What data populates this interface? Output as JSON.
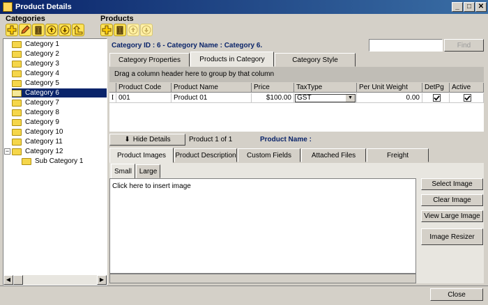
{
  "window": {
    "title": "Product Details",
    "min": "_",
    "max": "□",
    "close": "✕"
  },
  "headers": {
    "categories": "Categories",
    "products": "Products"
  },
  "toolbar_icons": {
    "categories": [
      "add-icon",
      "edit-icon",
      "delete-icon",
      "move-up-icon",
      "move-down-icon",
      "move-level-icon"
    ],
    "products": [
      "add-icon",
      "delete-icon",
      "move-up-icon",
      "move-down-icon"
    ]
  },
  "tree": {
    "items": [
      {
        "label": "Category 1"
      },
      {
        "label": "Category 2"
      },
      {
        "label": "Category 3"
      },
      {
        "label": "Category 4"
      },
      {
        "label": "Category 5"
      },
      {
        "label": "Category 6",
        "selected": true
      },
      {
        "label": "Category 7"
      },
      {
        "label": "Category 8"
      },
      {
        "label": "Category 9"
      },
      {
        "label": "Category 10"
      },
      {
        "label": "Category 11"
      },
      {
        "label": "Category 12"
      },
      {
        "label": "Sub Category 1"
      }
    ],
    "collapse_glyph": "−"
  },
  "category_header": "Category ID : 6 - Category Name : Category 6.",
  "search": {
    "value": "",
    "find_label": "Find"
  },
  "tabs": [
    "Category Properties",
    "Products in Category",
    "Category Style"
  ],
  "grid": {
    "group_hint": "Drag a column header here to group by that column",
    "columns": [
      "Product Code",
      "Product Name",
      "Price",
      "TaxType",
      "Per Unit Weight",
      "DetPg",
      "Active"
    ],
    "rows": [
      {
        "code": "001",
        "name": "Product 01",
        "price": "$100.00",
        "tax": "GST",
        "weight": "0.00",
        "detpg": true,
        "active": true
      }
    ],
    "row_indicator": "I"
  },
  "details": {
    "hide_label": "Hide Details",
    "counter": "Product 1 of 1",
    "product_name_label": "Product Name :"
  },
  "detail_tabs": [
    "Product Images",
    "Product Description",
    "Custom Fields",
    "Attached Files",
    "Freight"
  ],
  "image_tabs": [
    "Small",
    "Large"
  ],
  "image_hint": "Click here to insert image",
  "image_buttons": [
    "Select Image",
    "Clear Image",
    "View Large Image",
    "Image Resizer"
  ],
  "close_label": "Close"
}
